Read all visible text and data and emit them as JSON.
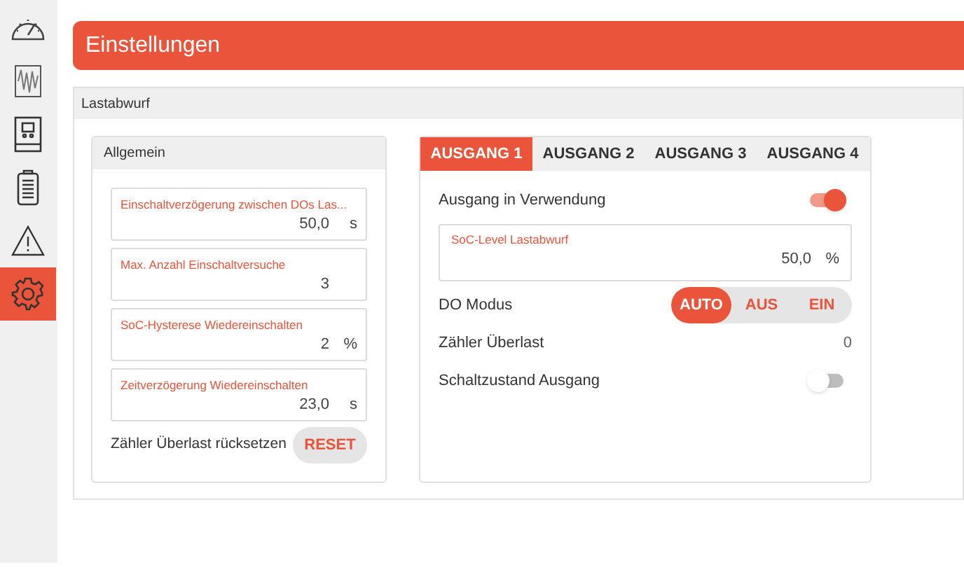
{
  "sidebar": {
    "items": [
      {
        "kind": "gauge",
        "selected": false
      },
      {
        "kind": "chart",
        "selected": false
      },
      {
        "kind": "device",
        "selected": false
      },
      {
        "kind": "battery",
        "selected": false
      },
      {
        "kind": "warning",
        "selected": false
      },
      {
        "kind": "settings",
        "selected": true
      }
    ]
  },
  "header": {
    "title": "Einstellungen"
  },
  "section": {
    "title": "Lastabwurf"
  },
  "general": {
    "title": "Allgemein",
    "fields": [
      {
        "label": "Einschaltverzögerung zwischen DOs Las...",
        "value": "50,0",
        "unit": "s"
      },
      {
        "label": "Max. Anzahl Einschaltversuche",
        "value": "3"
      },
      {
        "label": "SoC-Hysterese Wiedereinschalten",
        "value": "2",
        "unit": "%"
      },
      {
        "label": "Zeitverzögerung Wiedereinschalten",
        "value": "23,0",
        "unit": "s"
      }
    ],
    "reset": {
      "label": "Zähler Überlast rücksetzen",
      "button": "RESET"
    }
  },
  "outputs": {
    "tabs": [
      {
        "label": "AUSGANG 1",
        "selected": true
      },
      {
        "label": "AUSGANG 2",
        "selected": false
      },
      {
        "label": "AUSGANG 3",
        "selected": false
      },
      {
        "label": "AUSGANG 4",
        "selected": false
      }
    ],
    "in_use": {
      "label": "Ausgang in Verwendung",
      "on": true
    },
    "soc_field": {
      "label": "SoC-Level Lastabwurf",
      "value": "50,0",
      "unit": "%"
    },
    "mode": {
      "label": "DO Modus",
      "options": [
        {
          "label": "AUTO",
          "selected": true
        },
        {
          "label": "AUS",
          "selected": false
        },
        {
          "label": "EIN",
          "selected": false
        }
      ]
    },
    "counter": {
      "label": "Zähler Überlast",
      "value": "0"
    },
    "switch_state": {
      "label": "Schaltzustand Ausgang",
      "on": false
    }
  }
}
